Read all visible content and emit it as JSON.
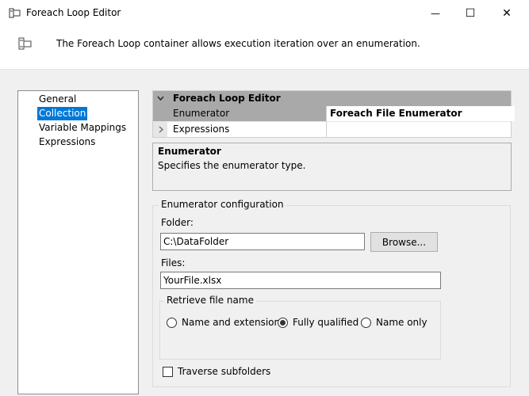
{
  "window": {
    "title": "Foreach Loop Editor",
    "minimize_glyph": "—",
    "maximize_glyph": "☐",
    "close_glyph": "✕",
    "icon": "foreach-loop-icon"
  },
  "header": {
    "description": "The Foreach Loop container allows execution iteration over an enumeration.",
    "icon": "foreach-container-icon"
  },
  "nav": {
    "items": [
      {
        "label": "General"
      },
      {
        "label": "Collection"
      },
      {
        "label": "Variable Mappings"
      },
      {
        "label": "Expressions"
      }
    ],
    "selected": "Collection"
  },
  "property_grid": {
    "category": "Foreach Loop Editor",
    "rows": [
      {
        "name": "Enumerator",
        "value": "Foreach File Enumerator"
      },
      {
        "name": "Expressions",
        "value": ""
      }
    ]
  },
  "help": {
    "title": "Enumerator",
    "description": "Specifies the enumerator type."
  },
  "config": {
    "group_label": "Enumerator configuration",
    "folder_label": "Folder:",
    "folder_value": "C:\\DataFolder",
    "browse_label": "Browse...",
    "files_label": "Files:",
    "files_value": "YourFile.xlsx",
    "retrieve_label": "Retrieve file name",
    "options": [
      {
        "label": "Name and extension",
        "selected": false
      },
      {
        "label": "Fully qualified",
        "selected": true
      },
      {
        "label": "Name only",
        "selected": false
      }
    ],
    "traverse_label": "Traverse subfolders",
    "traverse_checked": false
  },
  "colors": {
    "selection": "#0078d7",
    "category_header": "#a9a9a9"
  }
}
